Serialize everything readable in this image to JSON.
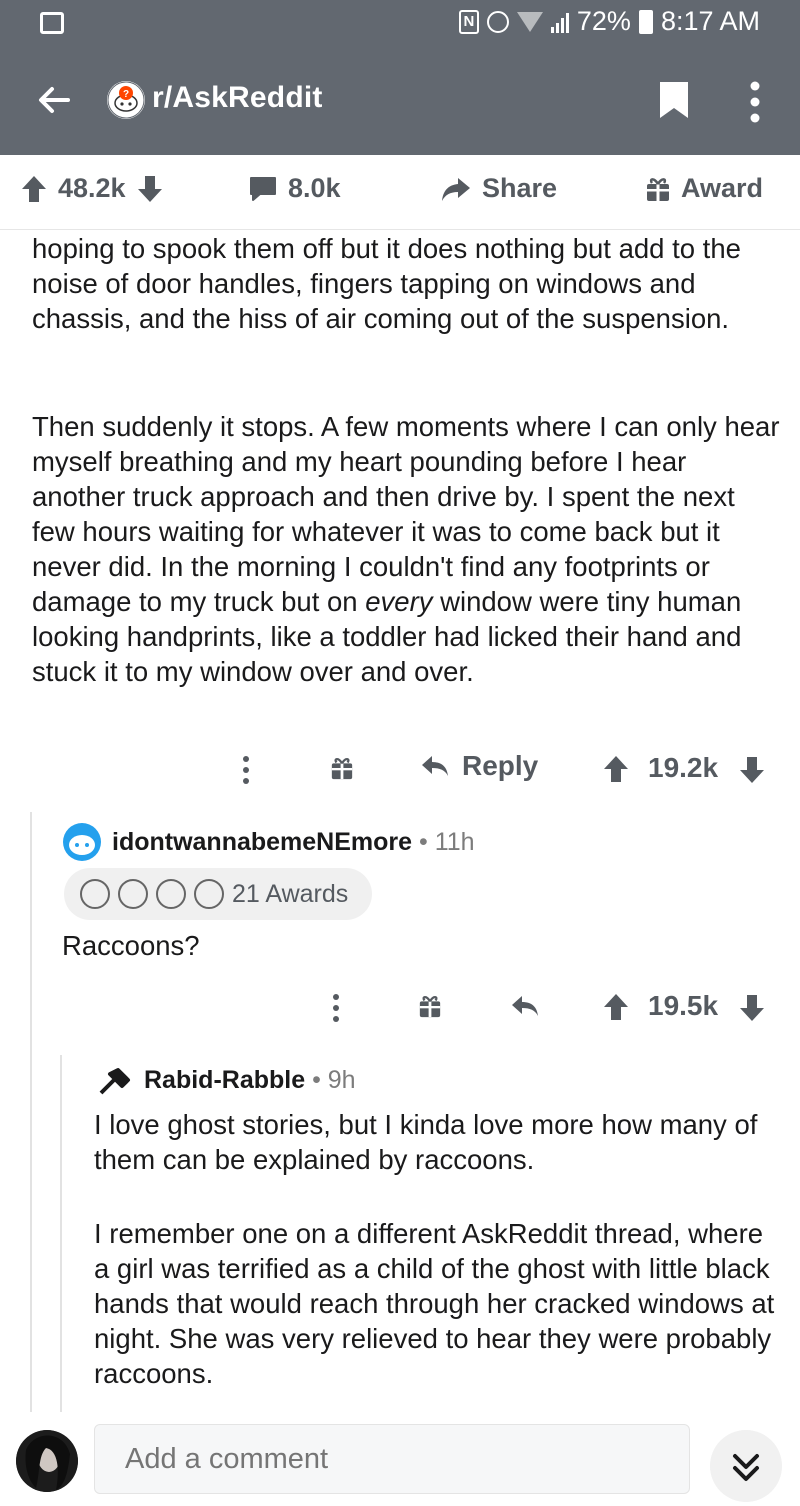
{
  "status_bar": {
    "battery": "72%",
    "time": "8:17 AM"
  },
  "app_bar": {
    "title": "r/AskReddit"
  },
  "post_actions": {
    "upvotes": "48.2k",
    "comments": "8.0k",
    "share_label": "Share",
    "award_label": "Award"
  },
  "comment_body": {
    "p1": "hoping to spook them off but it does nothing but add to the noise of door handles, fingers tapping on windows and chassis, and the hiss of air coming out of the suspension.",
    "p2_a": "Then suddenly it stops. A few moments where I can only hear myself breathing and my heart pounding before I hear another truck approach and then drive by. I spent the next few hours waiting for whatever it was to come back but it never did. In the morning I couldn't find any footprints or damage to my truck but on ",
    "p2_em": "every",
    "p2_b": " window were tiny human looking handprints, like a toddler had licked their hand and stuck it to my window over and over.",
    "reply_label": "Reply",
    "score": "19.2k"
  },
  "reply1": {
    "username": "idontwannabemeNEmore",
    "age": "11h",
    "awards_label": "21 Awards",
    "body": "Raccoons?",
    "score": "19.5k"
  },
  "reply2": {
    "username": "Rabid-Rabble",
    "age": "9h",
    "p1": "I love ghost stories, but I kinda love more how many of them can be explained by raccoons.",
    "p2": "I remember one on a different AskReddit thread, where a girl was terrified as a child of the ghost with little black hands that would reach through her cracked windows at night. She was very relieved to hear they were probably raccoons."
  },
  "comment_bar": {
    "placeholder": "Add a comment"
  }
}
